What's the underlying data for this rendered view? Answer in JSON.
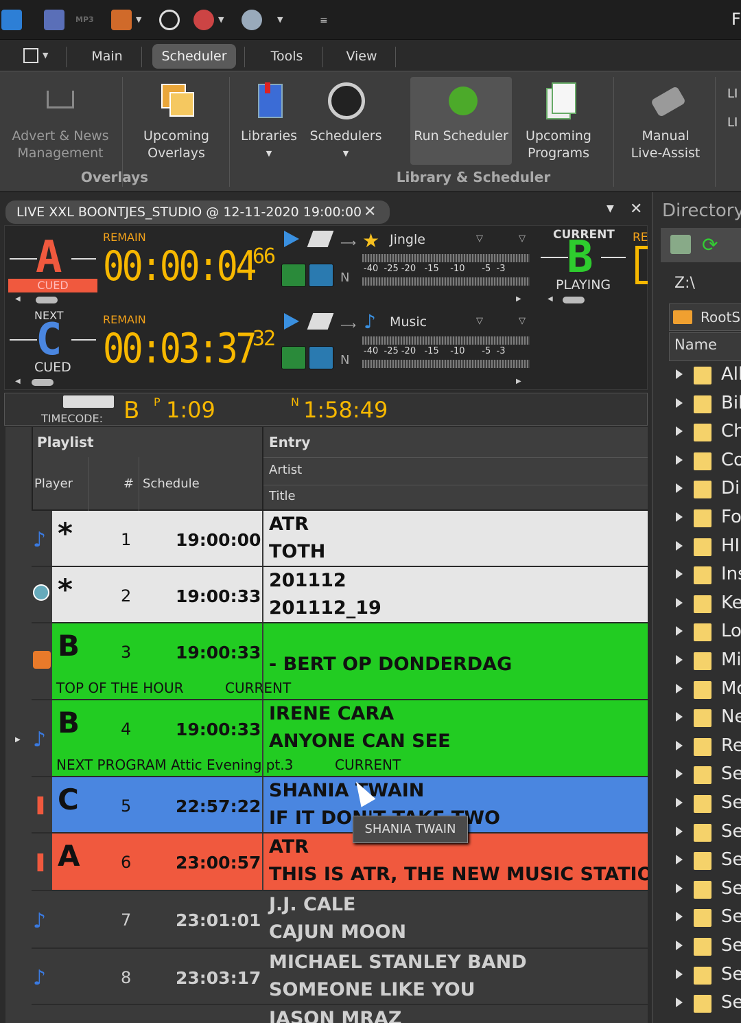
{
  "menu": {
    "tabs": [
      "Main",
      "Scheduler",
      "Tools",
      "View"
    ],
    "active": "Scheduler"
  },
  "qat": {
    "mp3_label": "MP3",
    "right_edge": "F"
  },
  "ribbon": {
    "buttons": [
      {
        "label": "Advert & News\nManagement"
      },
      {
        "label": "Upcoming\nOverlays"
      },
      {
        "label": "Libraries"
      },
      {
        "label": "Schedulers"
      },
      {
        "label": "Run Scheduler"
      },
      {
        "label": "Upcoming\nPrograms"
      },
      {
        "label": "Manual\nLive-Assist"
      }
    ],
    "groups": [
      "Overlays",
      "Library & Scheduler"
    ],
    "edge_items": [
      "LI",
      "LI"
    ]
  },
  "player": {
    "tab_title": "LIVE XXL BOONTJES_STUDIO @ 12-11-2020 19:00:00",
    "deckA": {
      "letter": "A",
      "status": "CUED",
      "remain_label": "REMAIN",
      "time": "00:00:04",
      "frac": "66",
      "category": "Jingle",
      "n": "N"
    },
    "deckC": {
      "letter": "C",
      "status": "CUED",
      "next_label": "NEXT",
      "remain_label": "REMAIN",
      "time": "00:03:37",
      "frac": "32",
      "category": "Music",
      "n": "N"
    },
    "deckB": {
      "letter": "B",
      "current_label": "CURRENT",
      "status": "PLAYING",
      "re_label": "RE"
    },
    "meter_scale": "-40  -25 -20   -15    -10      -5  -3",
    "timecode": {
      "label": "TIMECODE:",
      "deck": "B",
      "p_label": "P",
      "p_time": "1:09",
      "n_label": "N",
      "n_time": "1:58:49"
    }
  },
  "playlist": {
    "headers": {
      "playlist": "Playlist",
      "entry": "Entry",
      "artist": "Artist",
      "player": "Player",
      "num": "#",
      "schedule": "Schedule",
      "title": "Title"
    },
    "rows": [
      {
        "letter": "*",
        "num": "1",
        "time": "19:00:00",
        "artist": "ATR",
        "title": "TOTH",
        "color": "#e6e6e6",
        "icon": "note-icon"
      },
      {
        "letter": "*",
        "num": "2",
        "time": "19:00:33",
        "artist": "201112",
        "title": "201112_19",
        "color": "#e6e6e6",
        "icon": "clock-badge-icon"
      },
      {
        "letter": "B",
        "num": "3",
        "time": "19:00:33",
        "artist": "",
        "title": "- BERT OP DONDERDAG",
        "color": "#22cc22",
        "icon": "rss-icon",
        "sub1": "TOP OF THE HOUR",
        "sub2": "CURRENT"
      },
      {
        "letter": "B",
        "num": "4",
        "time": "19:00:33",
        "artist": "IRENE CARA",
        "title": "ANYONE CAN SEE",
        "color": "#22cc22",
        "icon": "note-icon",
        "sub1": "NEXT PROGRAM Attic Evening pt.3",
        "sub2": "CURRENT"
      },
      {
        "letter": "C",
        "num": "5",
        "time": "22:57:22",
        "artist": "SHANIA TWAIN",
        "title": "IF IT DON'T TAKE TWO",
        "color": "#4a86e0",
        "icon": "pause-icon"
      },
      {
        "letter": "A",
        "num": "6",
        "time": "23:00:57",
        "artist": "ATR",
        "title": "THIS IS ATR, THE NEW MUSIC STATION",
        "color": "#f0593e",
        "icon": "pause-icon"
      },
      {
        "letter": "",
        "num": "7",
        "time": "23:01:01",
        "artist": "J.J. CALE",
        "title": "CAJUN MOON",
        "color": "#3a3a3a",
        "icon": "note-icon"
      },
      {
        "letter": "",
        "num": "8",
        "time": "23:03:17",
        "artist": "MICHAEL STANLEY BAND",
        "title": "SOMEONE LIKE YOU",
        "color": "#3a3a3a",
        "icon": "note-icon"
      },
      {
        "letter": "",
        "num": "",
        "time": "",
        "artist": "JASON MRAZ",
        "title": "",
        "color": "#3a3a3a",
        "icon": ""
      }
    ],
    "tooltip": "SHANIA TWAIN"
  },
  "directory": {
    "title": "Directory",
    "path": "Z:\\",
    "root": "RootSu",
    "name_header": "Name",
    "folders": [
      "All",
      "Bil",
      "Ch",
      "Co",
      "Di",
      "Fo",
      "HI",
      "Ins",
      "Ke",
      "Lo",
      "Mi",
      "Mo",
      "Ne",
      "Re",
      "Se",
      "Se",
      "Se",
      "Se",
      "Se",
      "Se",
      "Se",
      "Se",
      "Se"
    ]
  }
}
